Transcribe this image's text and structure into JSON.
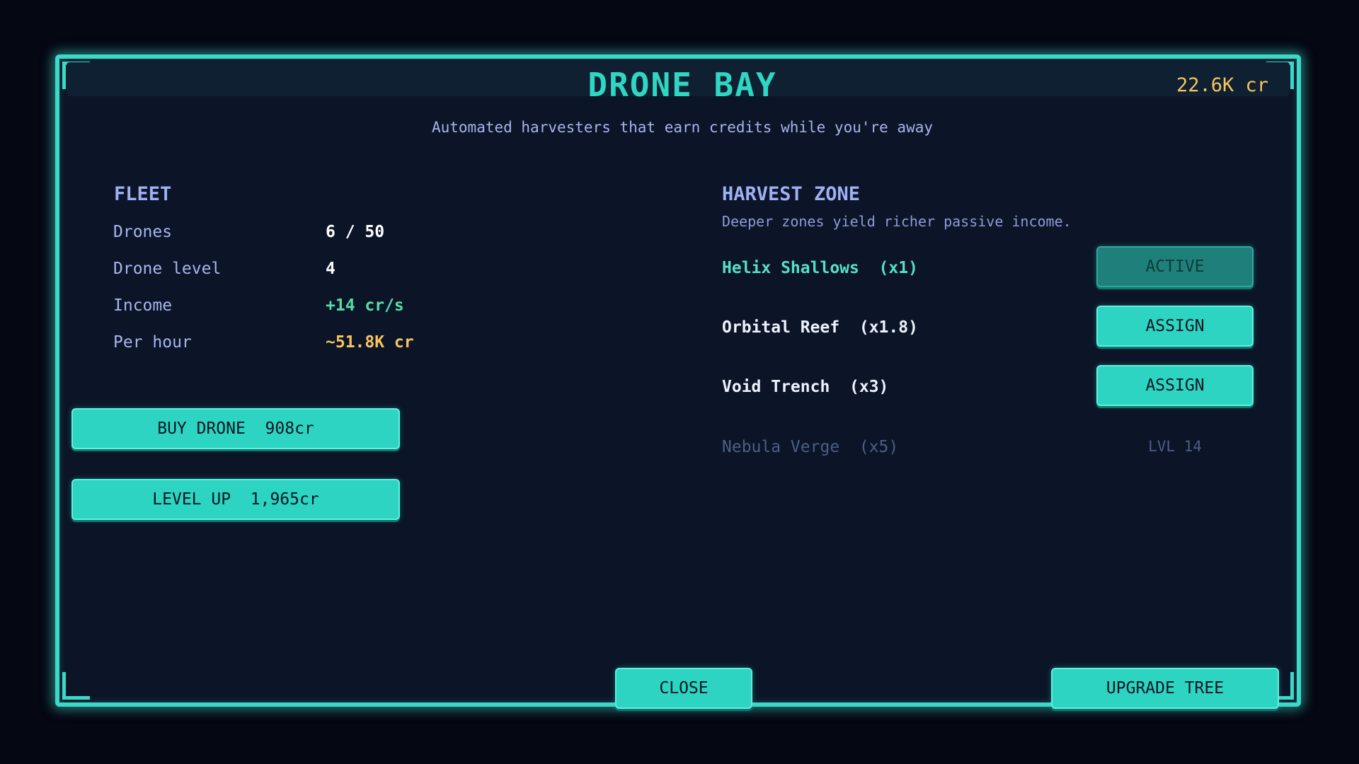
{
  "header": {
    "title": "DRONE BAY",
    "credits": "22.6K cr",
    "subtitle": "Automated harvesters that earn credits while you're away"
  },
  "fleet": {
    "heading": "FLEET",
    "stats": [
      {
        "label": "Drones",
        "value": "6 / 50",
        "color": "#ffffff"
      },
      {
        "label": "Drone level",
        "value": "4",
        "color": "#ffffff"
      },
      {
        "label": "Income",
        "value": "+14 cr/s",
        "color": "#56dfa8"
      },
      {
        "label": "Per hour",
        "value": "~51.8K cr",
        "color": "#f5c45e"
      }
    ],
    "buy_button": "BUY DRONE  908cr",
    "level_button": "LEVEL UP  1,965cr"
  },
  "harvest": {
    "heading": "HARVEST ZONE",
    "description": "Deeper zones yield richer passive income.",
    "zones": [
      {
        "name": "Helix Shallows  (x1)",
        "status": "ACTIVE",
        "state": "active"
      },
      {
        "name": "Orbital Reef  (x1.8)",
        "status": "ASSIGN",
        "state": "available"
      },
      {
        "name": "Void Trench  (x3)",
        "status": "ASSIGN",
        "state": "available"
      },
      {
        "name": "Nebula Verge  (x5)",
        "status": "LVL 14",
        "state": "locked"
      }
    ]
  },
  "footer": {
    "close_button": "CLOSE",
    "upgrade_button": "UPGRADE TREE"
  },
  "colors": {
    "accent": "#2dd4c2",
    "gold": "#f5c45e",
    "active_zone_text": "#56dfc8",
    "available_zone_text": "#eef2ff",
    "locked_zone_text": "#4d5d86"
  }
}
